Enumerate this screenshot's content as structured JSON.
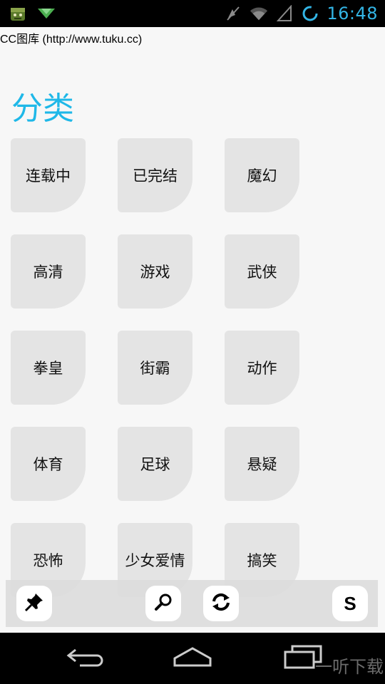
{
  "status_bar": {
    "time": "16:48",
    "left_icons": [
      "android-game-icon",
      "download-arrow-icon"
    ],
    "right_icons": [
      "mute-icon",
      "wifi-icon",
      "signal-icon",
      "sync-icon"
    ]
  },
  "app": {
    "title": "CC图库 (http://www.tuku.cc)"
  },
  "section": {
    "title": "分类"
  },
  "categories": [
    {
      "label": "连载中"
    },
    {
      "label": "已完结"
    },
    {
      "label": "魔幻"
    },
    {
      "label": "高清"
    },
    {
      "label": "游戏"
    },
    {
      "label": "武侠"
    },
    {
      "label": "拳皇"
    },
    {
      "label": "街霸"
    },
    {
      "label": "动作"
    },
    {
      "label": "体育"
    },
    {
      "label": "足球"
    },
    {
      "label": "悬疑"
    },
    {
      "label": "恐怖"
    },
    {
      "label": "少女爱情"
    },
    {
      "label": "搞笑"
    }
  ],
  "toolbar": {
    "buttons": [
      "pin-icon",
      "search-icon",
      "refresh-icon",
      "s-button"
    ],
    "s_label": "S"
  },
  "nav_bar": {
    "buttons": [
      "back-icon",
      "home-icon",
      "recent-apps-icon"
    ]
  },
  "watermark": {
    "text": "一听下载"
  },
  "colors": {
    "accent": "#1fb8e8",
    "status_blue": "#33b5e5",
    "tile_bg": "#e4e4e4",
    "page_bg": "#f7f7f7"
  }
}
